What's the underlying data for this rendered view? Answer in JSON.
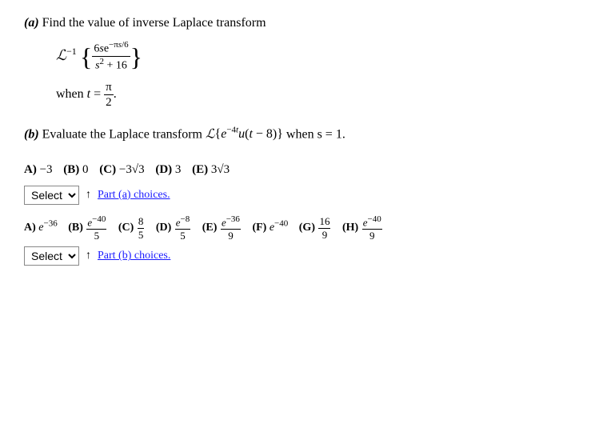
{
  "part_a": {
    "heading": "(a) Find the value of inverse Laplace transform",
    "heading_bold": "(a)",
    "heading_rest": " Find the value of inverse Laplace transform",
    "laplace_inv": "ℒ",
    "power_minus1": "−1",
    "fraction_numer": "6se",
    "exponent_numer": "−πs/6",
    "fraction_denom": "s² + 16",
    "when_text": "when t =",
    "when_value": "π/2",
    "choices_label": "Part (a) choices.",
    "choices": [
      {
        "label": "A",
        "value": "−3"
      },
      {
        "label": "B",
        "value": "0"
      },
      {
        "label": "C",
        "value": "−3√3"
      },
      {
        "label": "D",
        "value": "3"
      },
      {
        "label": "E",
        "value": "3√3"
      }
    ],
    "select_label": "Select",
    "up_arrow": "↑"
  },
  "part_b": {
    "heading_bold": "(b)",
    "heading_rest": " Evaluate the Laplace transform",
    "laplace": "ℒ",
    "expr": "{e",
    "exp_b": "−4t",
    "middle": "u(t − 8)}",
    "when_text": "when s = 1.",
    "choices_label": "Part (b) choices.",
    "choices": [
      {
        "label": "A",
        "value": "e",
        "sup": "−36",
        "prefix": ""
      },
      {
        "label": "B",
        "value": "e",
        "sup": "−40",
        "denom": "5",
        "prefix": ""
      },
      {
        "label": "C",
        "value": "8",
        "denom2": "5"
      },
      {
        "label": "D",
        "value": "e",
        "sup": "−8",
        "denom": "5"
      },
      {
        "label": "E",
        "value": "e",
        "sup": "−36",
        "denom": "9"
      },
      {
        "label": "F",
        "value": "e",
        "sup": "−40",
        "prefix": ""
      },
      {
        "label": "G",
        "value": "16",
        "denom": "9"
      },
      {
        "label": "H",
        "value": "e",
        "sup": "−40",
        "denom": "9"
      }
    ],
    "select_label": "Select",
    "up_arrow": "↑"
  }
}
